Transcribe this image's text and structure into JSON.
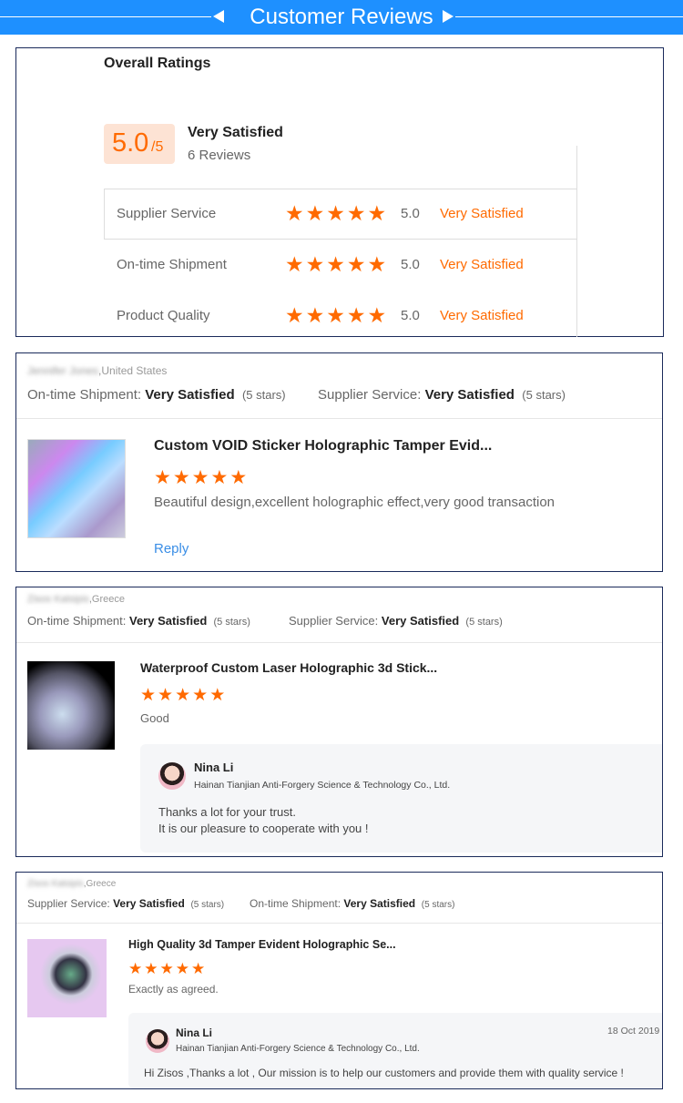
{
  "header": {
    "title": "Customer Reviews",
    "color": "#1e90ff"
  },
  "overall": {
    "heading": "Overall Ratings",
    "score": "5.0",
    "out_of": "/5",
    "label": "Very Satisfied",
    "reviews": "6 Reviews",
    "rows": [
      {
        "label": "Supplier Service",
        "value": "5.0",
        "text": "Very Satisfied",
        "stars": 5
      },
      {
        "label": "On-time Shipment",
        "value": "5.0",
        "text": "Very Satisfied",
        "stars": 5
      },
      {
        "label": "Product Quality",
        "value": "5.0",
        "text": "Very Satisfied",
        "stars": 5
      }
    ]
  },
  "reviews": [
    {
      "name": "Jennifer Jones",
      "country": ",United States",
      "r1_label": "On-time Shipment:",
      "r1_value": "Very Satisfied",
      "r1_stars": "(5 stars)",
      "r2_label": "Supplier Service:",
      "r2_value": "Very Satisfied",
      "r2_stars": "(5 stars)",
      "title": "Custom VOID Sticker Holographic Tamper Evid...",
      "stars": 5,
      "comment": "Beautiful design,excellent holographic effect,very good transaction",
      "reply_link": "Reply"
    },
    {
      "name": "Zisos Katsipis",
      "country": ",Greece",
      "r1_label": "On-time Shipment:",
      "r1_value": "Very Satisfied",
      "r1_stars": "(5 stars)",
      "r2_label": "Supplier Service:",
      "r2_value": "Very Satisfied",
      "r2_stars": "(5 stars)",
      "title": "Waterproof Custom Laser Holographic 3d Stick...",
      "stars": 5,
      "comment": "Good",
      "reply": {
        "name": "Nina Li",
        "company": "Hainan Tianjian Anti-Forgery Science & Technology Co., Ltd.",
        "line1": "Thanks a lot for your trust.",
        "line2": "It is our pleasure to cooperate with you !"
      }
    },
    {
      "name": "Zisos Katsipis",
      "country": ",Greece",
      "r1_label": "Supplier Service:",
      "r1_value": "Very Satisfied",
      "r1_stars": "(5 stars)",
      "r2_label": "On-time Shipment:",
      "r2_value": "Very Satisfied",
      "r2_stars": "(5 stars)",
      "title": "High Quality 3d Tamper Evident Holographic Se...",
      "stars": 5,
      "comment": "Exactly as agreed.",
      "reply": {
        "name": "Nina Li",
        "company": "Hainan Tianjian Anti-Forgery Science & Technology Co., Ltd.",
        "date": "18 Oct 2019",
        "line1": "Hi Zisos ,Thanks a lot ,  Our mission is to help our customers and provide them with quality service !"
      }
    }
  ],
  "colors": {
    "accent": "#ff6a00",
    "link": "#3a8ee6",
    "border": "#1a2a5a"
  }
}
